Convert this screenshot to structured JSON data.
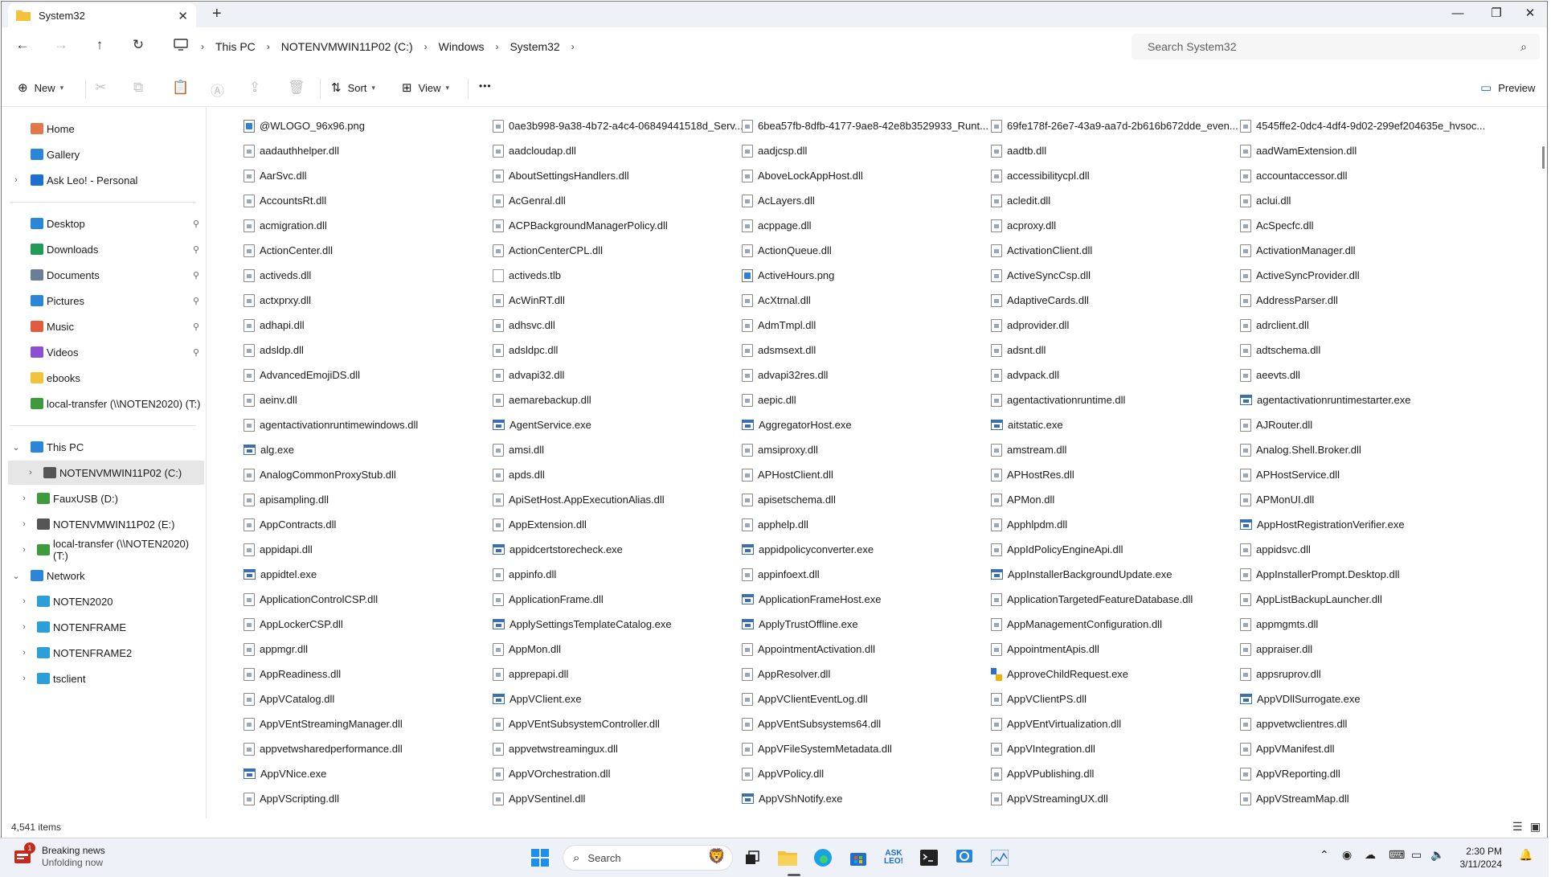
{
  "window": {
    "tab_title": "System32",
    "tab_close": "✕",
    "new_tab": "+",
    "minimize": "—",
    "maximize": "❐",
    "close": "✕"
  },
  "address": {
    "crumbs": [
      "This PC",
      "NOTENVMWIN11P02 (C:)",
      "Windows",
      "System32"
    ],
    "separator": "›",
    "search_placeholder": "Search System32"
  },
  "commands": {
    "new": "New",
    "sort": "Sort",
    "view": "View",
    "more": "•••",
    "preview": "Preview"
  },
  "sidebar": {
    "quick": [
      {
        "label": "Home",
        "icon": "home-icon"
      },
      {
        "label": "Gallery",
        "icon": "gallery-icon"
      },
      {
        "label": "Ask Leo! - Personal",
        "icon": "cloud-icon"
      }
    ],
    "pinned": [
      {
        "label": "Desktop",
        "icon": "desktop-icon"
      },
      {
        "label": "Downloads",
        "icon": "downloads-icon"
      },
      {
        "label": "Documents",
        "icon": "documents-icon"
      },
      {
        "label": "Pictures",
        "icon": "pictures-icon"
      },
      {
        "label": "Music",
        "icon": "music-icon"
      },
      {
        "label": "Videos",
        "icon": "videos-icon"
      },
      {
        "label": "ebooks",
        "icon": "folder-icon"
      },
      {
        "label": "local-transfer (\\\\NOTEN2020) (T:)",
        "icon": "network-drive-icon"
      }
    ],
    "tree": [
      {
        "label": "This PC",
        "icon": "pc-icon",
        "expanded": true
      },
      {
        "label": "NOTENVMWIN11P02 (C:)",
        "icon": "drive-icon",
        "selected": true
      },
      {
        "label": "FauxUSB (D:)",
        "icon": "usb-drive-icon"
      },
      {
        "label": "NOTENVMWIN11P02 (E:)",
        "icon": "drive-icon"
      },
      {
        "label": "local-transfer (\\\\NOTEN2020) (T:)",
        "icon": "network-drive-icon"
      },
      {
        "label": "Network",
        "icon": "network-icon",
        "expanded": true
      },
      {
        "label": "NOTEN2020",
        "icon": "computer-icon"
      },
      {
        "label": "NOTENFRAME",
        "icon": "computer-icon"
      },
      {
        "label": "NOTENFRAME2",
        "icon": "computer-icon"
      },
      {
        "label": "tsclient",
        "icon": "computer-icon"
      }
    ]
  },
  "files": [
    [
      "@WLOGO_96x96.png",
      "png"
    ],
    [
      "0ae3b998-9a38-4b72-a4c4-06849441518d_Serv...",
      "dll"
    ],
    [
      "6bea57fb-8dfb-4177-9ae8-42e8b3529933_Runt...",
      "dll"
    ],
    [
      "69fe178f-26e7-43a9-aa7d-2b616b672dde_even...",
      "dll"
    ],
    [
      "4545ffe2-0dc4-4df4-9d02-299ef204635e_hvsoc...",
      "dll"
    ],
    [
      "aadauthhelper.dll",
      "dll"
    ],
    [
      "aadcloudap.dll",
      "dll"
    ],
    [
      "aadjcsp.dll",
      "dll"
    ],
    [
      "aadtb.dll",
      "dll"
    ],
    [
      "aadWamExtension.dll",
      "dll"
    ],
    [
      "AarSvc.dll",
      "dll"
    ],
    [
      "AboutSettingsHandlers.dll",
      "dll"
    ],
    [
      "AboveLockAppHost.dll",
      "dll"
    ],
    [
      "accessibilitycpl.dll",
      "dll"
    ],
    [
      "accountaccessor.dll",
      "dll"
    ],
    [
      "AccountsRt.dll",
      "dll"
    ],
    [
      "AcGenral.dll",
      "dll"
    ],
    [
      "AcLayers.dll",
      "dll"
    ],
    [
      "acledit.dll",
      "dll"
    ],
    [
      "aclui.dll",
      "dll"
    ],
    [
      "acmigration.dll",
      "dll"
    ],
    [
      "ACPBackgroundManagerPolicy.dll",
      "dll"
    ],
    [
      "acppage.dll",
      "dll"
    ],
    [
      "acproxy.dll",
      "dll"
    ],
    [
      "AcSpecfc.dll",
      "dll"
    ],
    [
      "ActionCenter.dll",
      "dll"
    ],
    [
      "ActionCenterCPL.dll",
      "dll"
    ],
    [
      "ActionQueue.dll",
      "dll"
    ],
    [
      "ActivationClient.dll",
      "dll"
    ],
    [
      "ActivationManager.dll",
      "dll"
    ],
    [
      "activeds.dll",
      "dll"
    ],
    [
      "activeds.tlb",
      "tlb"
    ],
    [
      "ActiveHours.png",
      "png"
    ],
    [
      "ActiveSyncCsp.dll",
      "dll"
    ],
    [
      "ActiveSyncProvider.dll",
      "dll"
    ],
    [
      "actxprxy.dll",
      "dll"
    ],
    [
      "AcWinRT.dll",
      "dll"
    ],
    [
      "AcXtrnal.dll",
      "dll"
    ],
    [
      "AdaptiveCards.dll",
      "dll"
    ],
    [
      "AddressParser.dll",
      "dll"
    ],
    [
      "adhapi.dll",
      "dll"
    ],
    [
      "adhsvc.dll",
      "dll"
    ],
    [
      "AdmTmpl.dll",
      "dll"
    ],
    [
      "adprovider.dll",
      "dll"
    ],
    [
      "adrclient.dll",
      "dll"
    ],
    [
      "adsldp.dll",
      "dll"
    ],
    [
      "adsldpc.dll",
      "dll"
    ],
    [
      "adsmsext.dll",
      "dll"
    ],
    [
      "adsnt.dll",
      "dll"
    ],
    [
      "adtschema.dll",
      "dll"
    ],
    [
      "AdvancedEmojiDS.dll",
      "dll"
    ],
    [
      "advapi32.dll",
      "dll"
    ],
    [
      "advapi32res.dll",
      "dll"
    ],
    [
      "advpack.dll",
      "dll"
    ],
    [
      "aeevts.dll",
      "dll"
    ],
    [
      "aeinv.dll",
      "dll"
    ],
    [
      "aemarebackup.dll",
      "dll"
    ],
    [
      "aepic.dll",
      "dll"
    ],
    [
      "agentactivationruntime.dll",
      "dll"
    ],
    [
      "agentactivationruntimestarter.exe",
      "exe"
    ],
    [
      "agentactivationruntimewindows.dll",
      "dll"
    ],
    [
      "AgentService.exe",
      "exe"
    ],
    [
      "AggregatorHost.exe",
      "exe"
    ],
    [
      "aitstatic.exe",
      "exe"
    ],
    [
      "AJRouter.dll",
      "dll"
    ],
    [
      "alg.exe",
      "exe"
    ],
    [
      "amsi.dll",
      "dll"
    ],
    [
      "amsiproxy.dll",
      "dll"
    ],
    [
      "amstream.dll",
      "dll"
    ],
    [
      "Analog.Shell.Broker.dll",
      "dll"
    ],
    [
      "AnalogCommonProxyStub.dll",
      "dll"
    ],
    [
      "apds.dll",
      "dll"
    ],
    [
      "APHostClient.dll",
      "dll"
    ],
    [
      "APHostRes.dll",
      "dll"
    ],
    [
      "APHostService.dll",
      "dll"
    ],
    [
      "apisampling.dll",
      "dll"
    ],
    [
      "ApiSetHost.AppExecutionAlias.dll",
      "dll"
    ],
    [
      "apisetschema.dll",
      "dll"
    ],
    [
      "APMon.dll",
      "dll"
    ],
    [
      "APMonUI.dll",
      "dll"
    ],
    [
      "AppContracts.dll",
      "dll"
    ],
    [
      "AppExtension.dll",
      "dll"
    ],
    [
      "apphelp.dll",
      "dll"
    ],
    [
      "Apphlpdm.dll",
      "dll"
    ],
    [
      "AppHostRegistrationVerifier.exe",
      "exe"
    ],
    [
      "appidapi.dll",
      "dll"
    ],
    [
      "appidcertstorecheck.exe",
      "exe"
    ],
    [
      "appidpolicyconverter.exe",
      "exe"
    ],
    [
      "AppIdPolicyEngineApi.dll",
      "dll"
    ],
    [
      "appidsvc.dll",
      "dll"
    ],
    [
      "appidtel.exe",
      "exe"
    ],
    [
      "appinfo.dll",
      "dll"
    ],
    [
      "appinfoext.dll",
      "dll"
    ],
    [
      "AppInstallerBackgroundUpdate.exe",
      "exe"
    ],
    [
      "AppInstallerPrompt.Desktop.dll",
      "dll"
    ],
    [
      "ApplicationControlCSP.dll",
      "dll"
    ],
    [
      "ApplicationFrame.dll",
      "dll"
    ],
    [
      "ApplicationFrameHost.exe",
      "exe"
    ],
    [
      "ApplicationTargetedFeatureDatabase.dll",
      "dll"
    ],
    [
      "AppListBackupLauncher.dll",
      "dll"
    ],
    [
      "AppLockerCSP.dll",
      "dll"
    ],
    [
      "ApplySettingsTemplateCatalog.exe",
      "exe"
    ],
    [
      "ApplyTrustOffline.exe",
      "exe"
    ],
    [
      "AppManagementConfiguration.dll",
      "dll"
    ],
    [
      "appmgmts.dll",
      "dll"
    ],
    [
      "appmgr.dll",
      "dll"
    ],
    [
      "AppMon.dll",
      "dll"
    ],
    [
      "AppointmentActivation.dll",
      "dll"
    ],
    [
      "AppointmentApis.dll",
      "dll"
    ],
    [
      "appraiser.dll",
      "dll"
    ],
    [
      "AppReadiness.dll",
      "dll"
    ],
    [
      "apprepapi.dll",
      "dll"
    ],
    [
      "AppResolver.dll",
      "dll"
    ],
    [
      "ApproveChildRequest.exe",
      "shield"
    ],
    [
      "appsruprov.dll",
      "dll"
    ],
    [
      "AppVCatalog.dll",
      "dll"
    ],
    [
      "AppVClient.exe",
      "exe"
    ],
    [
      "AppVClientEventLog.dll",
      "dll"
    ],
    [
      "AppVClientPS.dll",
      "dll"
    ],
    [
      "AppVDllSurrogate.exe",
      "exe"
    ],
    [
      "AppVEntStreamingManager.dll",
      "dll"
    ],
    [
      "AppVEntSubsystemController.dll",
      "dll"
    ],
    [
      "AppVEntSubsystems64.dll",
      "dll"
    ],
    [
      "AppVEntVirtualization.dll",
      "dll"
    ],
    [
      "appvetwclientres.dll",
      "dll"
    ],
    [
      "appvetwsharedperformance.dll",
      "dll"
    ],
    [
      "appvetwstreamingux.dll",
      "dll"
    ],
    [
      "AppVFileSystemMetadata.dll",
      "dll"
    ],
    [
      "AppVIntegration.dll",
      "dll"
    ],
    [
      "AppVManifest.dll",
      "dll"
    ],
    [
      "AppVNice.exe",
      "exe"
    ],
    [
      "AppVOrchestration.dll",
      "dll"
    ],
    [
      "AppVPolicy.dll",
      "dll"
    ],
    [
      "AppVPublishing.dll",
      "dll"
    ],
    [
      "AppVReporting.dll",
      "dll"
    ],
    [
      "AppVScripting.dll",
      "dll"
    ],
    [
      "AppVSentinel.dll",
      "dll"
    ],
    [
      "AppVShNotify.exe",
      "exe"
    ],
    [
      "AppVStreamingUX.dll",
      "dll"
    ],
    [
      "AppVStreamMap.dll",
      "dll"
    ]
  ],
  "status": {
    "count": "4,541 items"
  },
  "taskbar": {
    "news_badge": "1",
    "news_title": "Breaking news",
    "news_sub": "Unfolding now",
    "search": "Search",
    "time": "2:30 PM",
    "date": "3/11/2024"
  }
}
